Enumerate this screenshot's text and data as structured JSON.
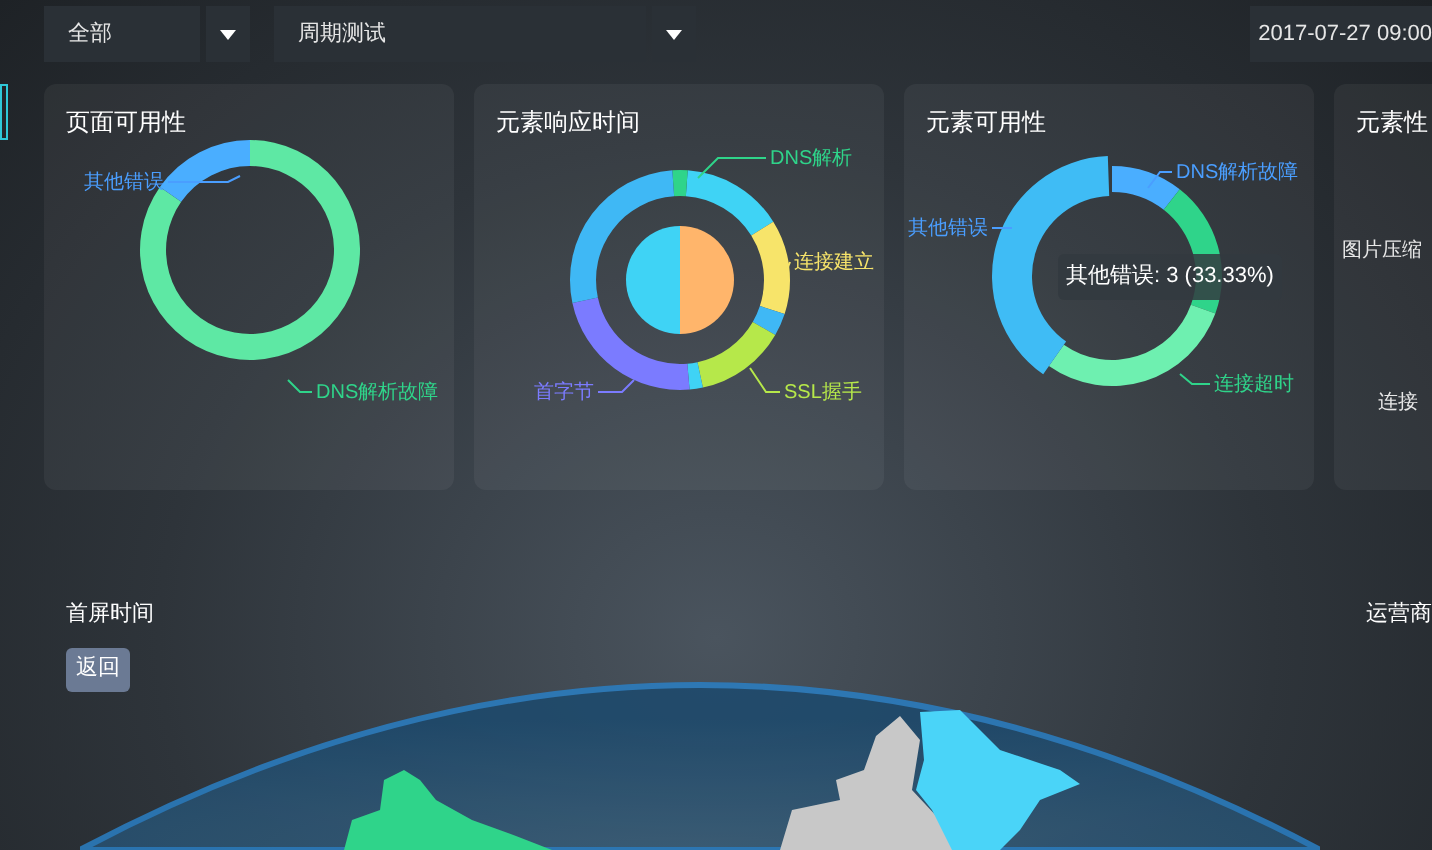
{
  "filters": [
    {
      "value": "全部"
    },
    {
      "value": "周期测试"
    }
  ],
  "datetime": "2017-07-27 09:00",
  "cards": [
    {
      "title": "页面可用性",
      "kind": "ring",
      "labels": [
        {
          "text": "其他错误",
          "color": "#4a9eff"
        },
        {
          "text": "DNS解析故障",
          "color": "#2fd48a"
        }
      ]
    },
    {
      "title": "元素响应时间",
      "kind": "ring_pie",
      "labels": [
        {
          "text": "DNS解析",
          "color": "#2fd48a"
        },
        {
          "text": "连接建立",
          "color": "#f7e46a"
        },
        {
          "text": "首字节",
          "color": "#7b7bff"
        },
        {
          "text": "SSL握手",
          "color": "#b6e84a"
        }
      ]
    },
    {
      "title": "元素可用性",
      "kind": "ring_highlight",
      "labels": [
        {
          "text": "DNS解析故障",
          "color": "#4a9eff"
        },
        {
          "text": "其他错误",
          "color": "#4a9eff"
        },
        {
          "text": "连接超时",
          "color": "#2fd48a"
        }
      ],
      "tooltip": "其他错误: 3 (33.33%)"
    },
    {
      "title": "元素性",
      "kind": "partial",
      "labels": [
        {
          "text": "图片压缩",
          "color": "#e8e8e8"
        },
        {
          "text": "连接",
          "color": "#e8e8e8"
        }
      ]
    }
  ],
  "first_screen": {
    "title": "首屏时间",
    "button": "返回"
  },
  "operator_title": "运营商"
}
